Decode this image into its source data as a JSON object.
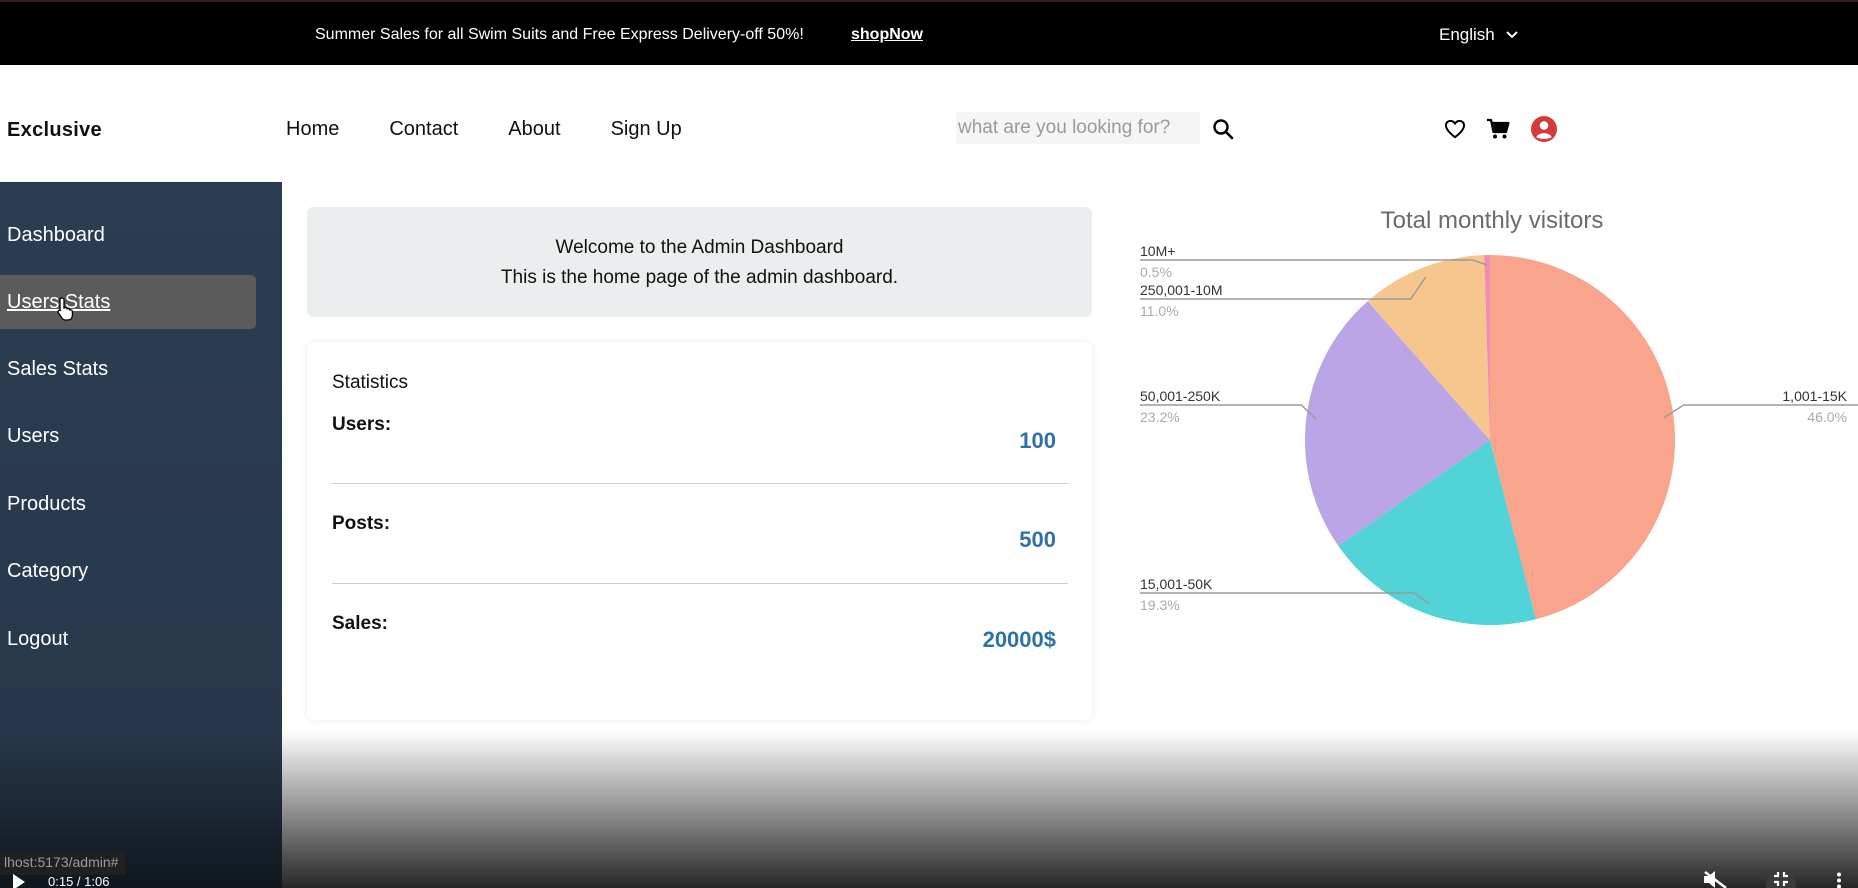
{
  "banner": {
    "promo_text": "Summer Sales for all Swim Suits and Free Express Delivery-off 50%!",
    "shop_link": "shopNow",
    "language": "English"
  },
  "header": {
    "logo": "Exclusive",
    "nav": [
      "Home",
      "Contact",
      "About",
      "Sign Up"
    ],
    "search_placeholder": "what are you looking for?",
    "icons": [
      "heart-icon",
      "cart-icon",
      "user-account-icon"
    ]
  },
  "sidebar": {
    "items": [
      {
        "label": "Dashboard"
      },
      {
        "label": "Users Stats"
      },
      {
        "label": "Sales Stats"
      },
      {
        "label": "Users"
      },
      {
        "label": "Products"
      },
      {
        "label": "Category"
      },
      {
        "label": "Logout"
      }
    ],
    "active_index": 1
  },
  "welcome": {
    "line1": "Welcome to the Admin Dashboard",
    "line2": "This is the home page of the admin dashboard."
  },
  "statistics": {
    "title": "Statistics",
    "rows": [
      {
        "label": "Users:",
        "value": "100"
      },
      {
        "label": "Posts:",
        "value": "500"
      },
      {
        "label": "Sales:",
        "value": "20000$"
      }
    ]
  },
  "chart_data": {
    "type": "pie",
    "title": "Total monthly visitors",
    "slices": [
      {
        "label": "1,001-15K",
        "value": 46.0,
        "percent": "46.0%",
        "color": "#f9a48c"
      },
      {
        "label": "15,001-50K",
        "value": 19.3,
        "percent": "19.3%",
        "color": "#52d3d8"
      },
      {
        "label": "50,001-250K",
        "value": 23.2,
        "percent": "23.2%",
        "color": "#bba5e6"
      },
      {
        "label": "250,001-10M",
        "value": 11.0,
        "percent": "11.0%",
        "color": "#f5c78f"
      },
      {
        "label": "10M+",
        "value": 0.5,
        "percent": "0.5%",
        "color": "#f28cb1"
      }
    ]
  },
  "status_bar": {
    "url": "lhost:5173/admin#"
  },
  "video": {
    "time": "0:15 / 1:06"
  },
  "colors": {
    "sidebar_bg": "#2b3d51",
    "stat_value": "#2f72a8",
    "user_icon": "#d23b3b"
  }
}
